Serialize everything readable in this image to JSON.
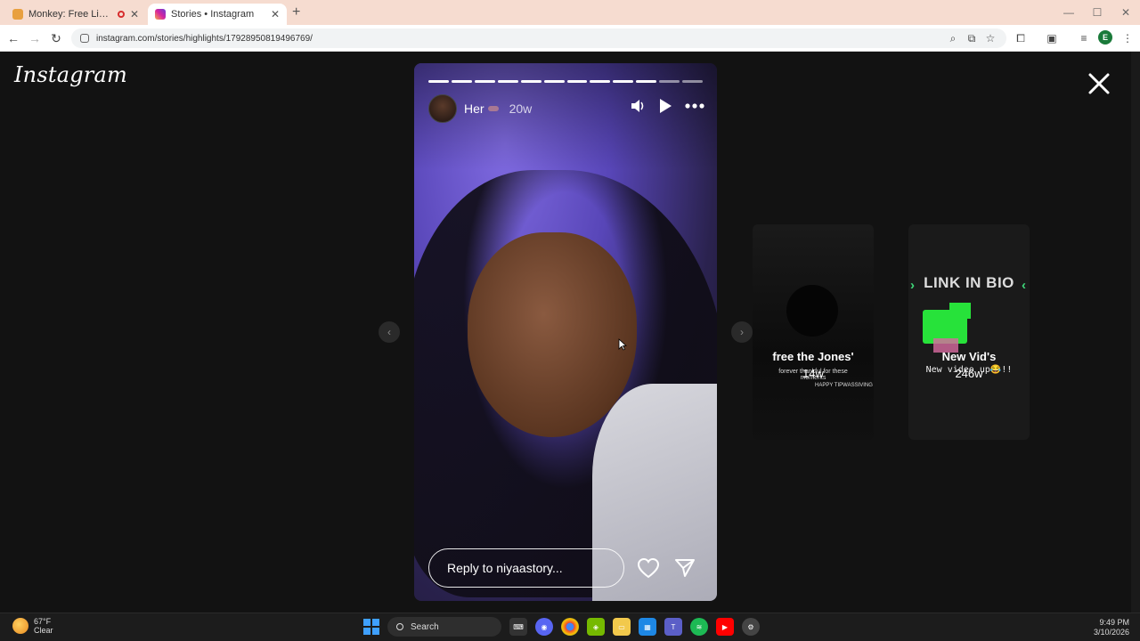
{
  "browser": {
    "tabs": [
      {
        "title": "Monkey: Free Live Video Ch",
        "active": false,
        "recording": true
      },
      {
        "title": "Stories • Instagram",
        "active": true
      }
    ],
    "url": "instagram.com/stories/highlights/17928950819496769/"
  },
  "instagram": {
    "logo": "Instagram",
    "story": {
      "username": "Her",
      "time_ago": "20w",
      "reply_placeholder": "Reply to niyaastory...",
      "progress_segments": 12,
      "progress_done": 10
    },
    "previews": [
      {
        "label": "free the Jones'",
        "time_ago": "14w",
        "caption": "forever thankful for these moments",
        "tag": "HAPPY TIPWASSIVING"
      },
      {
        "label": "New Vid's",
        "time_ago": "246w",
        "banner": "LINK IN BIO",
        "caption": "New video up😂!!"
      }
    ]
  },
  "taskbar": {
    "weather_temp": "67°F",
    "weather_desc": "Clear",
    "search_label": "Search",
    "time": "9:49 PM",
    "date": "3/10/2026"
  },
  "colors": {
    "accent_green": "#27e23a",
    "tabbar_bg": "#f6dcd0",
    "page_bg": "#121212"
  }
}
